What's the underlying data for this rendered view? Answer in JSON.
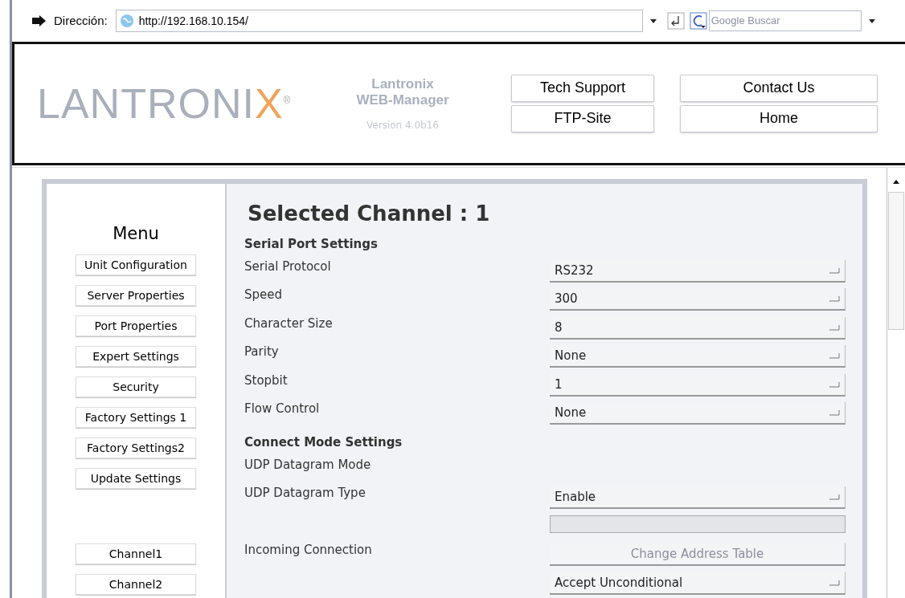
{
  "browser": {
    "address_label": "Dirección:",
    "url": "http://192.168.10.154/",
    "search": {
      "placeholder": "Google Buscar"
    }
  },
  "header": {
    "logo": {
      "text": "LANTRONI",
      "accent": "X",
      "mark": "®"
    },
    "product": "Lantronix",
    "app": "WEB-Manager",
    "version": "Version 4.0b16",
    "buttons": [
      "Tech Support",
      "FTP-Site",
      "Contact Us",
      "Home"
    ]
  },
  "menu": {
    "title": "Menu",
    "items": [
      "Unit Configuration",
      "Server Properties",
      "Port Properties",
      "Expert Settings",
      "Security",
      "Factory Settings 1",
      "Factory Settings2",
      "Update Settings"
    ],
    "channels": [
      "Channel1",
      "Channel2"
    ]
  },
  "content": {
    "title": "Selected Channel : 1",
    "rows": [
      {
        "kind": "section",
        "label": "Serial Port Settings"
      },
      {
        "kind": "select",
        "label": "Serial Protocol",
        "value": "RS232"
      },
      {
        "kind": "select",
        "label": "Speed",
        "value": "300"
      },
      {
        "kind": "select",
        "label": "Character Size",
        "value": "8"
      },
      {
        "kind": "select",
        "label": "Parity",
        "value": "None"
      },
      {
        "kind": "select",
        "label": "Stopbit",
        "value": "1"
      },
      {
        "kind": "select",
        "label": "Flow Control",
        "value": "None"
      },
      {
        "kind": "section",
        "label": "Connect Mode Settings"
      },
      {
        "kind": "label",
        "label": "UDP Datagram Mode"
      },
      {
        "kind": "select",
        "label": "UDP Datagram Type",
        "value": "Enable"
      },
      {
        "kind": "text_field",
        "disabled": true
      },
      {
        "kind": "button",
        "label": "Incoming Connection",
        "button": "Change Address Table",
        "disabled": true
      },
      {
        "kind": "select",
        "value": "Accept Unconditional"
      }
    ]
  }
}
